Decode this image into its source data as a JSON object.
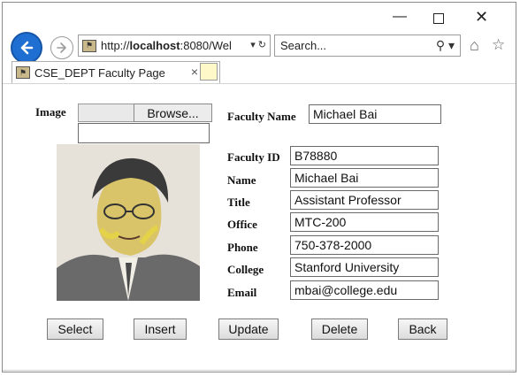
{
  "window": {
    "minimize_glyph": "—",
    "close_glyph": "✕"
  },
  "nav": {
    "address_prefix": "http://",
    "address_host": "localhost",
    "address_rest": ":8080/Wel",
    "address_tools": "▾ ↻",
    "search_placeholder": "Search...",
    "search_tools": "⚲ ▾"
  },
  "tab": {
    "title": "CSE_DEPT Faculty Page",
    "close": "×"
  },
  "form": {
    "image_label": "Image",
    "browse_label": "Browse...",
    "faculty_name_label": "Faculty Name",
    "faculty_name_value": "Michael Bai",
    "fields": [
      {
        "label": "Faculty ID",
        "value": "B78880"
      },
      {
        "label": "Name",
        "value": "Michael Bai"
      },
      {
        "label": "Title",
        "value": "Assistant Professor"
      },
      {
        "label": "Office",
        "value": "MTC-200"
      },
      {
        "label": "Phone",
        "value": "750-378-2000"
      },
      {
        "label": "College",
        "value": "Stanford University"
      },
      {
        "label": "Email",
        "value": "mbai@college.edu"
      }
    ]
  },
  "buttons": {
    "select": "Select",
    "insert": "Insert",
    "update": "Update",
    "delete": "Delete",
    "back": "Back"
  },
  "colors": {
    "back_button": "#1e6fd1",
    "photo_accent": "#e8d93a"
  }
}
